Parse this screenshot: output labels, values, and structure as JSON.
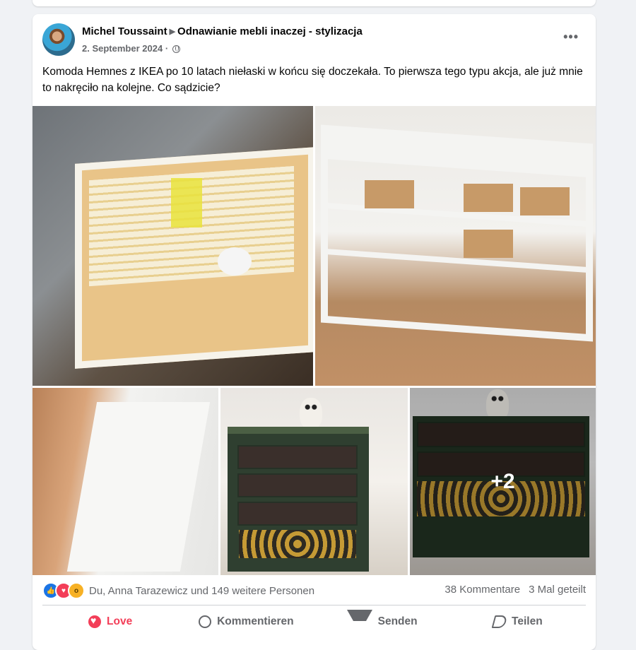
{
  "post": {
    "author": "Michel Toussaint",
    "group": "Odnawianie mebli inaczej - stylizacja",
    "date": "2. September 2024",
    "date_separator": "·",
    "more_label": "•••",
    "text": "Komoda Hemnes z IKEA po 10 latach niełaski w końcu się doczekała. To pierwsza tego typu akcja, ale już mnie to nakręciło na kolejne. Co sądzicie?",
    "photos": {
      "extra_count": "+2"
    },
    "reactions": {
      "icons": [
        "like-icon",
        "love-icon",
        "wow-icon"
      ],
      "summary": "Du, Anna Tarazewicz und 149 weitere Personen",
      "comments": "38 Kommentare",
      "shares": "3 Mal geteilt"
    },
    "actions": {
      "love": "Love",
      "comment": "Kommentieren",
      "send": "Senden",
      "share": "Teilen"
    }
  },
  "colors": {
    "love": "#f33e58",
    "like": "#1b74e4",
    "wow": "#f7b125",
    "muted_text": "#65676b"
  }
}
